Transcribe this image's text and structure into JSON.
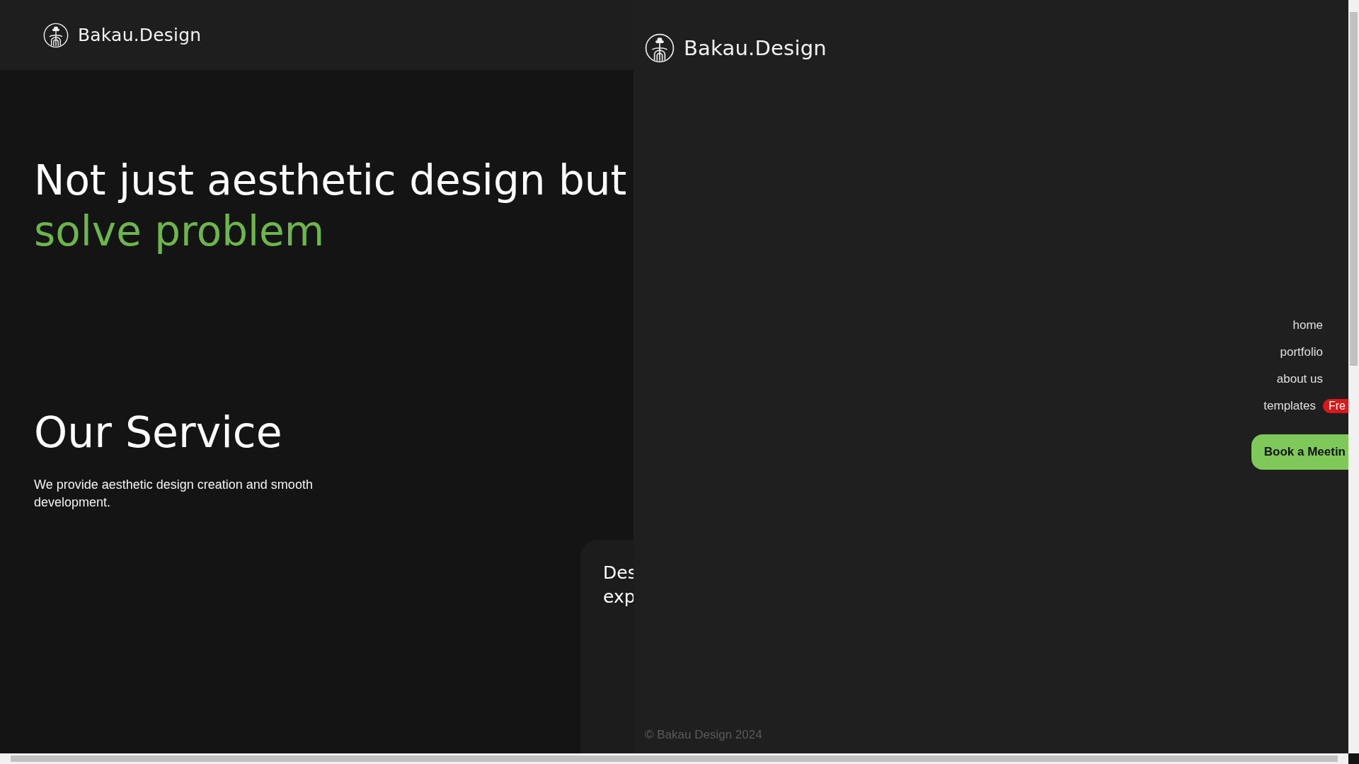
{
  "header": {
    "brand": "Bakau.Design"
  },
  "hero": {
    "line_1": "Not just aesthetic design but",
    "line_2": "solve problem"
  },
  "service": {
    "title": "Our Service",
    "description": "We provide aesthetic design creation and smooth development."
  },
  "service_card": {
    "title_lines": [
      "Des",
      "exp"
    ]
  },
  "drawer": {
    "brand": "Bakau.Design",
    "nav": [
      {
        "label": "home"
      },
      {
        "label": "portfolio"
      },
      {
        "label": "about us"
      },
      {
        "label": "templates",
        "badge": "Fre"
      }
    ],
    "cta": "Book a Meetin",
    "footer": "© Bakau Design 2024"
  }
}
